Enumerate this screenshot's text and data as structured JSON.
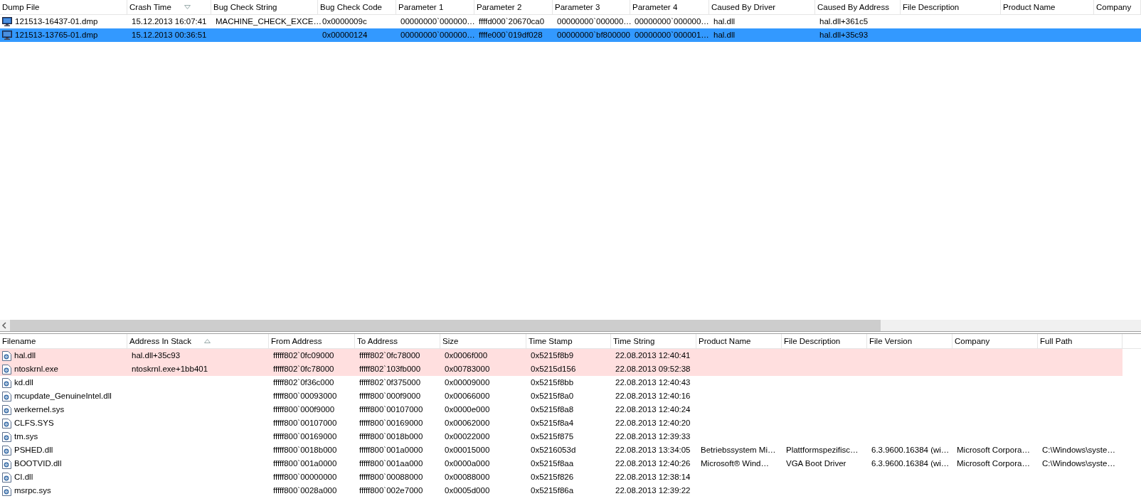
{
  "top_table": {
    "columns": [
      {
        "label": "Dump File",
        "sorted_ascending": false,
        "sorted_descending": false
      },
      {
        "label": "Crash Time",
        "sorted_ascending": false,
        "sorted_descending": true
      },
      {
        "label": "Bug Check String",
        "sorted_ascending": false,
        "sorted_descending": false
      },
      {
        "label": "Bug Check Code",
        "sorted_ascending": false,
        "sorted_descending": false
      },
      {
        "label": "Parameter 1",
        "sorted_ascending": false,
        "sorted_descending": false
      },
      {
        "label": "Parameter 2",
        "sorted_ascending": false,
        "sorted_descending": false
      },
      {
        "label": "Parameter 3",
        "sorted_ascending": false,
        "sorted_descending": false
      },
      {
        "label": "Parameter 4",
        "sorted_ascending": false,
        "sorted_descending": false
      },
      {
        "label": "Caused By Driver",
        "sorted_ascending": false,
        "sorted_descending": false
      },
      {
        "label": "Caused By Address",
        "sorted_ascending": false,
        "sorted_descending": false
      },
      {
        "label": "File Description",
        "sorted_ascending": false,
        "sorted_descending": false
      },
      {
        "label": "Product Name",
        "sorted_ascending": false,
        "sorted_descending": false
      },
      {
        "label": "Company",
        "sorted_ascending": false,
        "sorted_descending": false
      }
    ],
    "rows": [
      {
        "selected": false,
        "dump_file": "121513-16437-01.dmp",
        "crash_time": "15.12.2013 16:07:41",
        "bug_check_string": "MACHINE_CHECK_EXCE…",
        "bug_check_code": "0x0000009c",
        "parameter_1": "00000000`000000…",
        "parameter_2": "ffffd000`20670ca0",
        "parameter_3": "00000000`000000…",
        "parameter_4": "00000000`000000…",
        "caused_by_driver": "hal.dll",
        "caused_by_address": "hal.dll+361c5"
      },
      {
        "selected": true,
        "dump_file": "121513-13765-01.dmp",
        "crash_time": "15.12.2013 00:36:51",
        "bug_check_code": "0x00000124",
        "parameter_1": "00000000`000000…",
        "parameter_2": "ffffe000`019df028",
        "parameter_3": "00000000`bf800000",
        "parameter_4": "00000000`000001…",
        "caused_by_driver": "hal.dll",
        "caused_by_address": "hal.dll+35c93"
      }
    ]
  },
  "bottom_table": {
    "columns": [
      {
        "label": "Filename",
        "sorted_ascending": false,
        "sorted_descending": false
      },
      {
        "label": "Address In Stack",
        "sorted_ascending": true,
        "sorted_descending": false
      },
      {
        "label": "From Address",
        "sorted_ascending": false,
        "sorted_descending": false
      },
      {
        "label": "To Address",
        "sorted_ascending": false,
        "sorted_descending": false
      },
      {
        "label": "Size",
        "sorted_ascending": false,
        "sorted_descending": false
      },
      {
        "label": "Time Stamp",
        "sorted_ascending": false,
        "sorted_descending": false
      },
      {
        "label": "Time String",
        "sorted_ascending": false,
        "sorted_descending": false
      },
      {
        "label": "Product Name",
        "sorted_ascending": false,
        "sorted_descending": false
      },
      {
        "label": "File Description",
        "sorted_ascending": false,
        "sorted_descending": false
      },
      {
        "label": "File Version",
        "sorted_ascending": false,
        "sorted_descending": false
      },
      {
        "label": "Company",
        "sorted_ascending": false,
        "sorted_descending": false
      },
      {
        "label": "Full Path",
        "sorted_ascending": false,
        "sorted_descending": false
      }
    ],
    "rows": [
      {
        "highlighted": true,
        "filename": "hal.dll",
        "address_in_stack": "hal.dll+35c93",
        "from_address": "fffff802`0fc09000",
        "to_address": "fffff802`0fc78000",
        "size": "0x0006f000",
        "time_stamp": "0x5215f8b9",
        "time_string": "22.08.2013 12:40:41"
      },
      {
        "highlighted": true,
        "filename": "ntoskrnl.exe",
        "address_in_stack": "ntoskrnl.exe+1bb401",
        "from_address": "fffff802`0fc78000",
        "to_address": "fffff802`103fb000",
        "size": "0x00783000",
        "time_stamp": "0x5215d156",
        "time_string": "22.08.2013 09:52:38"
      },
      {
        "highlighted": false,
        "filename": "kd.dll",
        "from_address": "fffff802`0f36c000",
        "to_address": "fffff802`0f375000",
        "size": "0x00009000",
        "time_stamp": "0x5215f8bb",
        "time_string": "22.08.2013 12:40:43"
      },
      {
        "highlighted": false,
        "filename": "mcupdate_GenuineIntel.dll",
        "from_address": "fffff800`00093000",
        "to_address": "fffff800`000f9000",
        "size": "0x00066000",
        "time_stamp": "0x5215f8a0",
        "time_string": "22.08.2013 12:40:16"
      },
      {
        "highlighted": false,
        "filename": "werkernel.sys",
        "from_address": "fffff800`000f9000",
        "to_address": "fffff800`00107000",
        "size": "0x0000e000",
        "time_stamp": "0x5215f8a8",
        "time_string": "22.08.2013 12:40:24"
      },
      {
        "highlighted": false,
        "filename": "CLFS.SYS",
        "from_address": "fffff800`00107000",
        "to_address": "fffff800`00169000",
        "size": "0x00062000",
        "time_stamp": "0x5215f8a4",
        "time_string": "22.08.2013 12:40:20"
      },
      {
        "highlighted": false,
        "filename": "tm.sys",
        "from_address": "fffff800`00169000",
        "to_address": "fffff800`0018b000",
        "size": "0x00022000",
        "time_stamp": "0x5215f875",
        "time_string": "22.08.2013 12:39:33"
      },
      {
        "highlighted": false,
        "filename": "PSHED.dll",
        "from_address": "fffff800`0018b000",
        "to_address": "fffff800`001a0000",
        "size": "0x00015000",
        "time_stamp": "0x5216053d",
        "time_string": "22.08.2013 13:34:05",
        "product_name": "Betriebssystem Mi…",
        "file_description": "Plattformspezifisc…",
        "file_version": "6.3.9600.16384 (wi…",
        "company": "Microsoft Corpora…",
        "full_path": "C:\\Windows\\syste…"
      },
      {
        "highlighted": false,
        "filename": "BOOTVID.dll",
        "from_address": "fffff800`001a0000",
        "to_address": "fffff800`001aa000",
        "size": "0x0000a000",
        "time_stamp": "0x5215f8aa",
        "time_string": "22.08.2013 12:40:26",
        "product_name": "Microsoft® Wind…",
        "file_description": "VGA Boot Driver",
        "file_version": "6.3.9600.16384 (wi…",
        "company": "Microsoft Corpora…",
        "full_path": "C:\\Windows\\syste…"
      },
      {
        "highlighted": false,
        "filename": "CI.dll",
        "from_address": "fffff800`00000000",
        "to_address": "fffff800`00088000",
        "size": "0x00088000",
        "time_stamp": "0x5215f826",
        "time_string": "22.08.2013 12:38:14"
      },
      {
        "highlighted": false,
        "filename": "msrpc.sys",
        "from_address": "fffff800`0028a000",
        "to_address": "fffff800`002e7000",
        "size": "0x0005d000",
        "time_stamp": "0x5215f86a",
        "time_string": "22.08.2013 12:39:22"
      }
    ]
  }
}
